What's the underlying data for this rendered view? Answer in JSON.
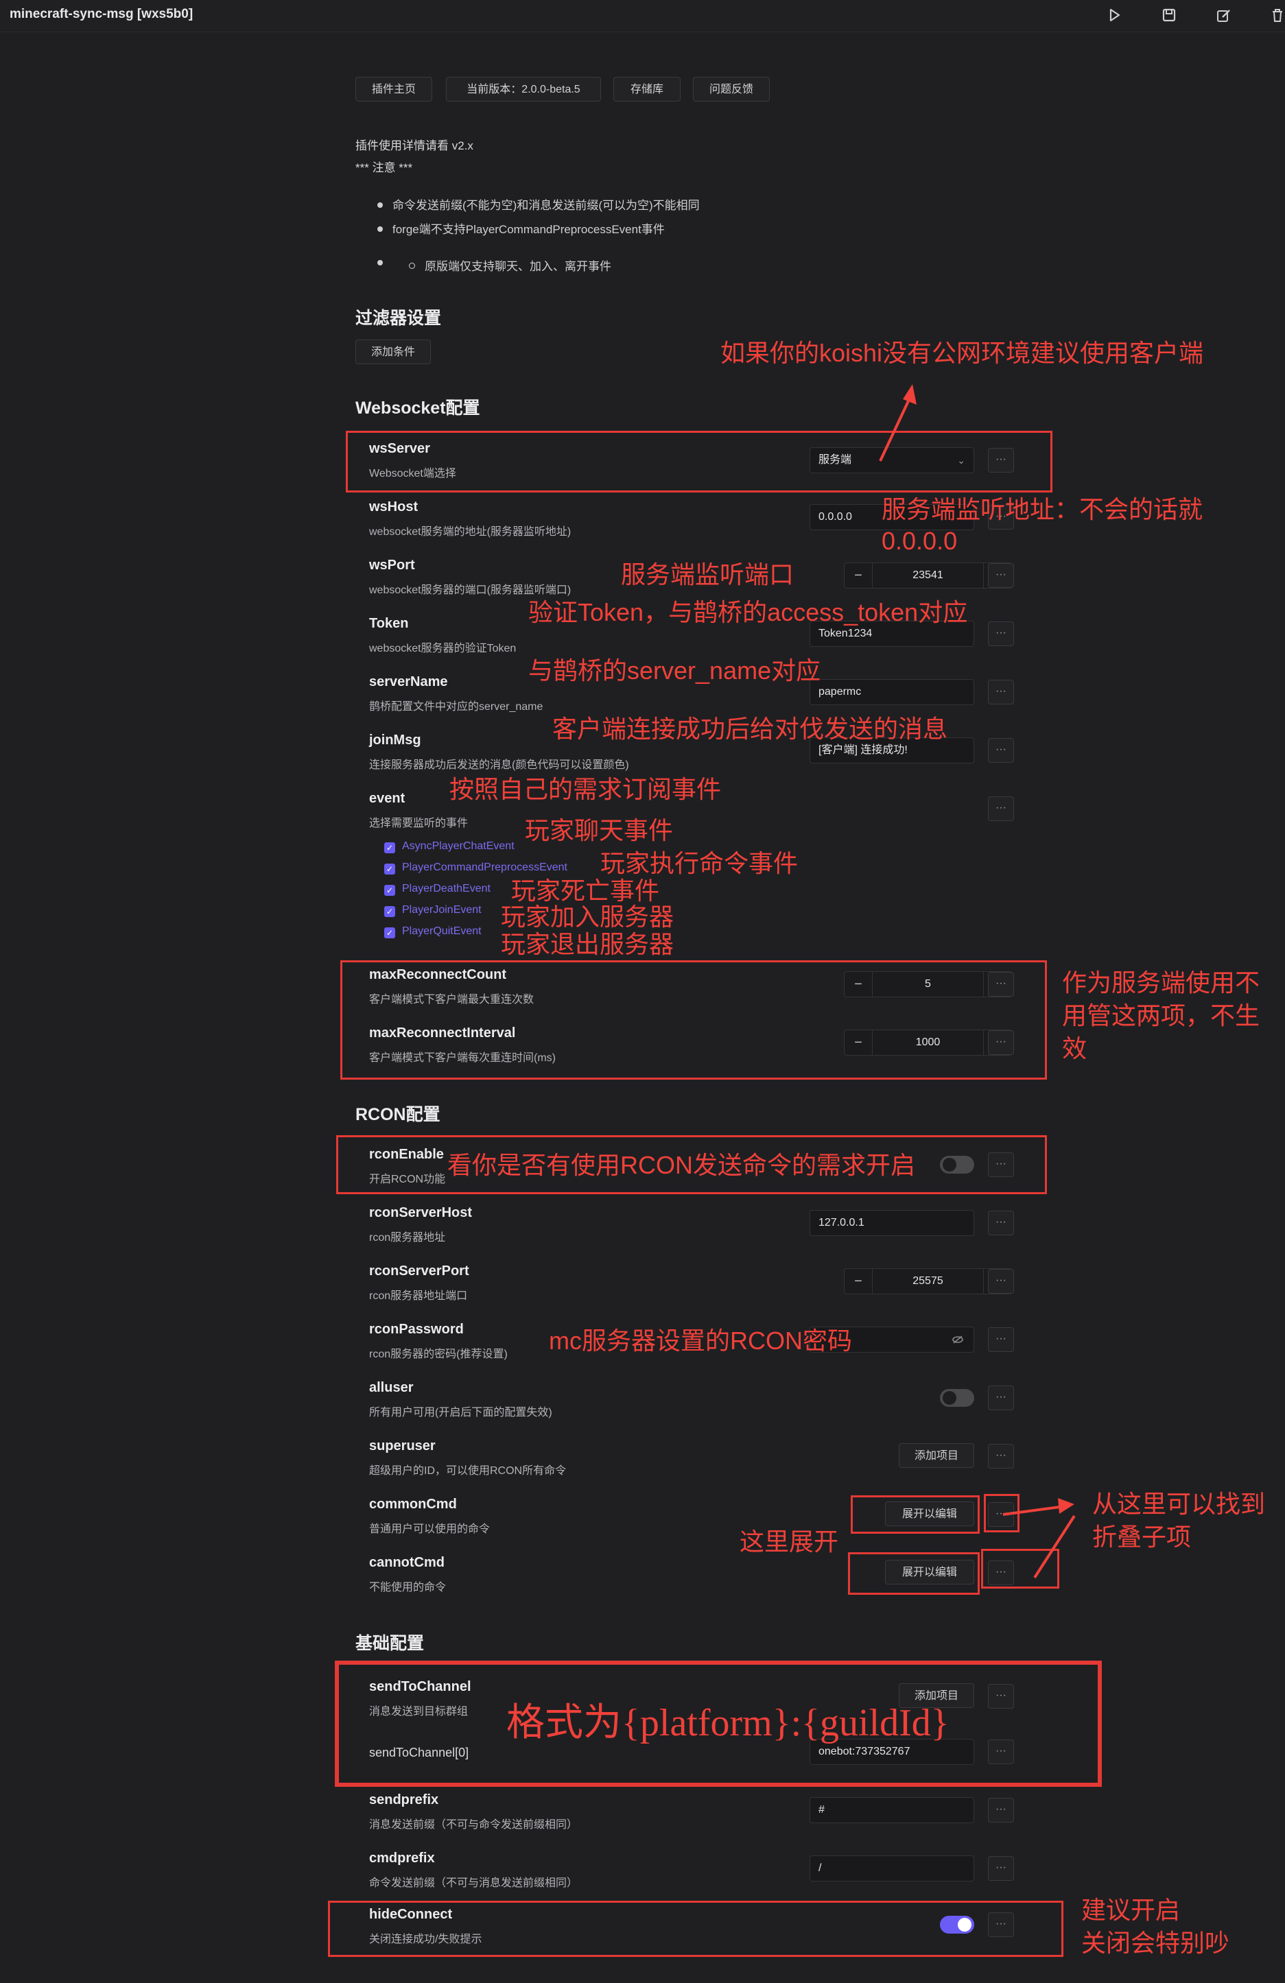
{
  "window": {
    "title": "minecraft-sync-msg [wxs5b0]"
  },
  "toolbar_icons": [
    "play-icon",
    "save-icon",
    "edit-icon",
    "trash-icon"
  ],
  "header_buttons": {
    "home": "插件主页",
    "version": "当前版本：2.0.0-beta.5",
    "repo": "存储库",
    "feedback": "问题反馈"
  },
  "intro": {
    "usage": "插件使用详情请看 v2.x",
    "note": "*** 注意 ***",
    "bullets": [
      "命令发送前缀(不能为空)和消息发送前缀(可以为空)不能相同",
      "forge端不支持PlayerCommandPreprocessEvent事件"
    ],
    "sub_bullet": "原版端仅支持聊天、加入、离开事件"
  },
  "filter": {
    "title": "过滤器设置",
    "add_button": "添加条件"
  },
  "websocket": {
    "title": "Websocket配置",
    "wsServer": {
      "label": "wsServer",
      "desc": "Websocket端选择",
      "value": "服务端"
    },
    "wsHost": {
      "label": "wsHost",
      "desc": "websocket服务端的地址(服务器监听地址)",
      "value": "0.0.0.0"
    },
    "wsPort": {
      "label": "wsPort",
      "desc": "websocket服务器的端口(服务器监听端口)",
      "value": "23541"
    },
    "token": {
      "label": "Token",
      "desc": "websocket服务器的验证Token",
      "value": "Token1234"
    },
    "serverName": {
      "label": "serverName",
      "desc": "鹊桥配置文件中对应的server_name",
      "value": "papermc"
    },
    "joinMsg": {
      "label": "joinMsg",
      "desc": "连接服务器成功后发送的消息(颜色代码可以设置颜色)",
      "value": "[客户端] 连接成功!"
    },
    "event": {
      "label": "event",
      "desc": "选择需要监听的事件"
    },
    "events": [
      "AsyncPlayerChatEvent",
      "PlayerCommandPreprocessEvent",
      "PlayerDeathEvent",
      "PlayerJoinEvent",
      "PlayerQuitEvent"
    ],
    "maxReconnectCount": {
      "label": "maxReconnectCount",
      "desc": "客户端模式下客户端最大重连次数",
      "value": "5"
    },
    "maxReconnectInterval": {
      "label": "maxReconnectInterval",
      "desc": "客户端模式下客户端每次重连时间(ms)",
      "value": "1000"
    }
  },
  "rcon": {
    "title": "RCON配置",
    "rconEnable": {
      "label": "rconEnable",
      "desc": "开启RCON功能"
    },
    "rconServerHost": {
      "label": "rconServerHost",
      "desc": "rcon服务器地址",
      "value": "127.0.0.1"
    },
    "rconServerPort": {
      "label": "rconServerPort",
      "desc": "rcon服务器地址端口",
      "value": "25575"
    },
    "rconPassword": {
      "label": "rconPassword",
      "desc": "rcon服务器的密码(推荐设置)"
    },
    "alluser": {
      "label": "alluser",
      "desc": "所有用户可用(开启后下面的配置失效)"
    },
    "superuser": {
      "label": "superuser",
      "desc": "超级用户的ID，可以使用RCON所有命令",
      "button": "添加项目"
    },
    "commonCmd": {
      "label": "commonCmd",
      "desc": "普通用户可以使用的命令",
      "button": "展开以编辑"
    },
    "cannotCmd": {
      "label": "cannotCmd",
      "desc": "不能使用的命令",
      "button": "展开以编辑"
    }
  },
  "basic": {
    "title": "基础配置",
    "sendToChannel": {
      "label": "sendToChannel",
      "desc": "消息发送到目标群组",
      "button": "添加项目"
    },
    "sendToChannel0": {
      "label": "sendToChannel[0]",
      "value": "onebot:737352767"
    },
    "sendprefix": {
      "label": "sendprefix",
      "desc": "消息发送前缀（不可与命令发送前缀相同）",
      "value": "#"
    },
    "cmdprefix": {
      "label": "cmdprefix",
      "desc": "命令发送前缀（不可与消息发送前缀相同）",
      "value": "/"
    },
    "hideConnect": {
      "label": "hideConnect",
      "desc": "关闭连接成功/失败提示"
    }
  },
  "more_glyph": "···",
  "stepper": {
    "minus": "−",
    "plus": "+"
  },
  "annotations": {
    "client_tip": "如果你的koishi没有公网环境建议使用客户端",
    "host_tip_1": "服务端监听地址：不会的话就",
    "host_tip_2": "0.0.0.0",
    "port_tip": "服务端监听端口",
    "token_tip": "验证Token，与鹊桥的access_token对应",
    "servername_tip": "与鹊桥的server_name对应",
    "joinmsg_tip": "客户端连接成功后给对伐发送的消息",
    "event_tip": "按照自己的需求订阅事件",
    "chat_tip": "玩家聊天事件",
    "command_tip": "玩家执行命令事件",
    "death_tip": "玩家死亡事件",
    "join_tip": "玩家加入服务器",
    "quit_tip": "玩家退出服务器",
    "reconnect_tip_1": "作为服务端使用不",
    "reconnect_tip_2": "用管这两项，不生",
    "reconnect_tip_3": "效",
    "rcon_enable_tip": "看你是否有使用RCON发送命令的需求开启",
    "rcon_password_tip": "mc服务器设置的RCON密码",
    "expand_tip": "这里展开",
    "fold_tip_1": "从这里可以找到",
    "fold_tip_2": "折叠子项",
    "channel_tip": "格式为{platform}:{guildId}",
    "hide_tip_1": "建议开启",
    "hide_tip_2": "关闭会特别吵"
  },
  "colors": {
    "accent": "#6a5cf5",
    "annotation": "#f0413a",
    "background": "#1f1f21"
  }
}
